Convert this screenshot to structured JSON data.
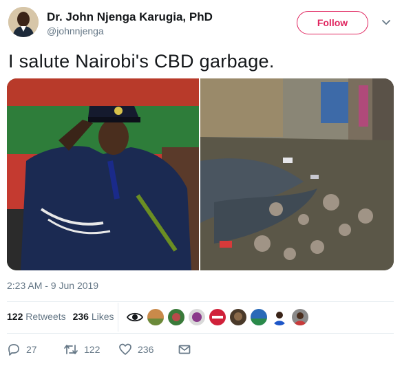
{
  "author": {
    "name": "Dr. John Njenga Karugia, PhD",
    "handle": "@johnnjenga"
  },
  "follow_label": "Follow",
  "tweet": {
    "text": "I salute Nairobi's CBD garbage."
  },
  "timestamp": "2:23 AM - 9 Jun 2019",
  "stats": {
    "retweets_count": "122",
    "retweets_label": "Retweets",
    "likes_count": "236",
    "likes_label": "Likes"
  },
  "actions": {
    "reply_count": "27",
    "retweet_count": "122",
    "like_count": "236"
  },
  "icons": [
    "chevron-down-icon",
    "eye-icon",
    "reply-icon",
    "retweet-icon",
    "heart-icon",
    "mail-icon"
  ],
  "colors": {
    "follow_accent": "#e0245e",
    "muted": "#657786"
  }
}
